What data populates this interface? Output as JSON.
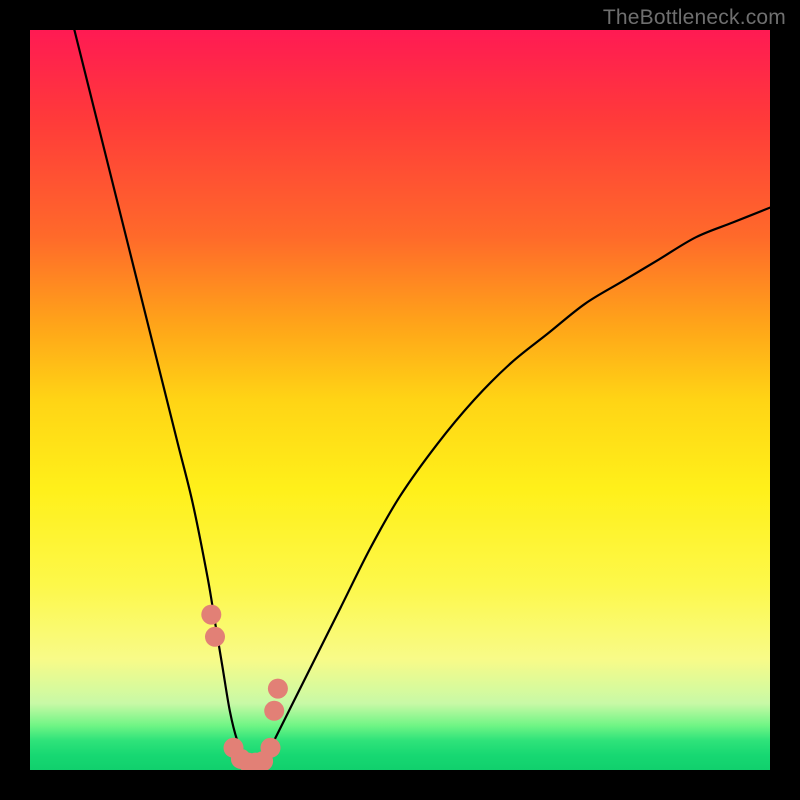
{
  "watermark": "TheBottleneck.com",
  "chart_data": {
    "type": "line",
    "title": "",
    "xlabel": "",
    "ylabel": "",
    "xlim": [
      0,
      100
    ],
    "ylim": [
      0,
      100
    ],
    "curve": {
      "x": [
        6,
        8,
        10,
        12,
        14,
        16,
        18,
        20,
        22,
        24,
        25,
        26,
        27,
        28,
        29,
        30,
        31,
        32,
        33,
        35,
        38,
        42,
        46,
        50,
        55,
        60,
        65,
        70,
        75,
        80,
        85,
        90,
        95,
        100
      ],
      "y": [
        100,
        92,
        84,
        76,
        68,
        60,
        52,
        44,
        36,
        26,
        20,
        14,
        8,
        4,
        2,
        1,
        1,
        2,
        4,
        8,
        14,
        22,
        30,
        37,
        44,
        50,
        55,
        59,
        63,
        66,
        69,
        72,
        74,
        76
      ]
    },
    "markers": {
      "x": [
        24.5,
        25.0,
        27.5,
        28.5,
        29.5,
        30.5,
        31.5,
        32.5,
        33.0,
        33.5
      ],
      "y": [
        21,
        18,
        3,
        1.5,
        1,
        1,
        1.2,
        3,
        8,
        11
      ]
    },
    "gradient_stops": [
      {
        "pos": 0.0,
        "color": "#ff1a53"
      },
      {
        "pos": 0.5,
        "color": "#ffd415"
      },
      {
        "pos": 0.85,
        "color": "#f8fb88"
      },
      {
        "pos": 1.0,
        "color": "#11d06d"
      }
    ]
  }
}
